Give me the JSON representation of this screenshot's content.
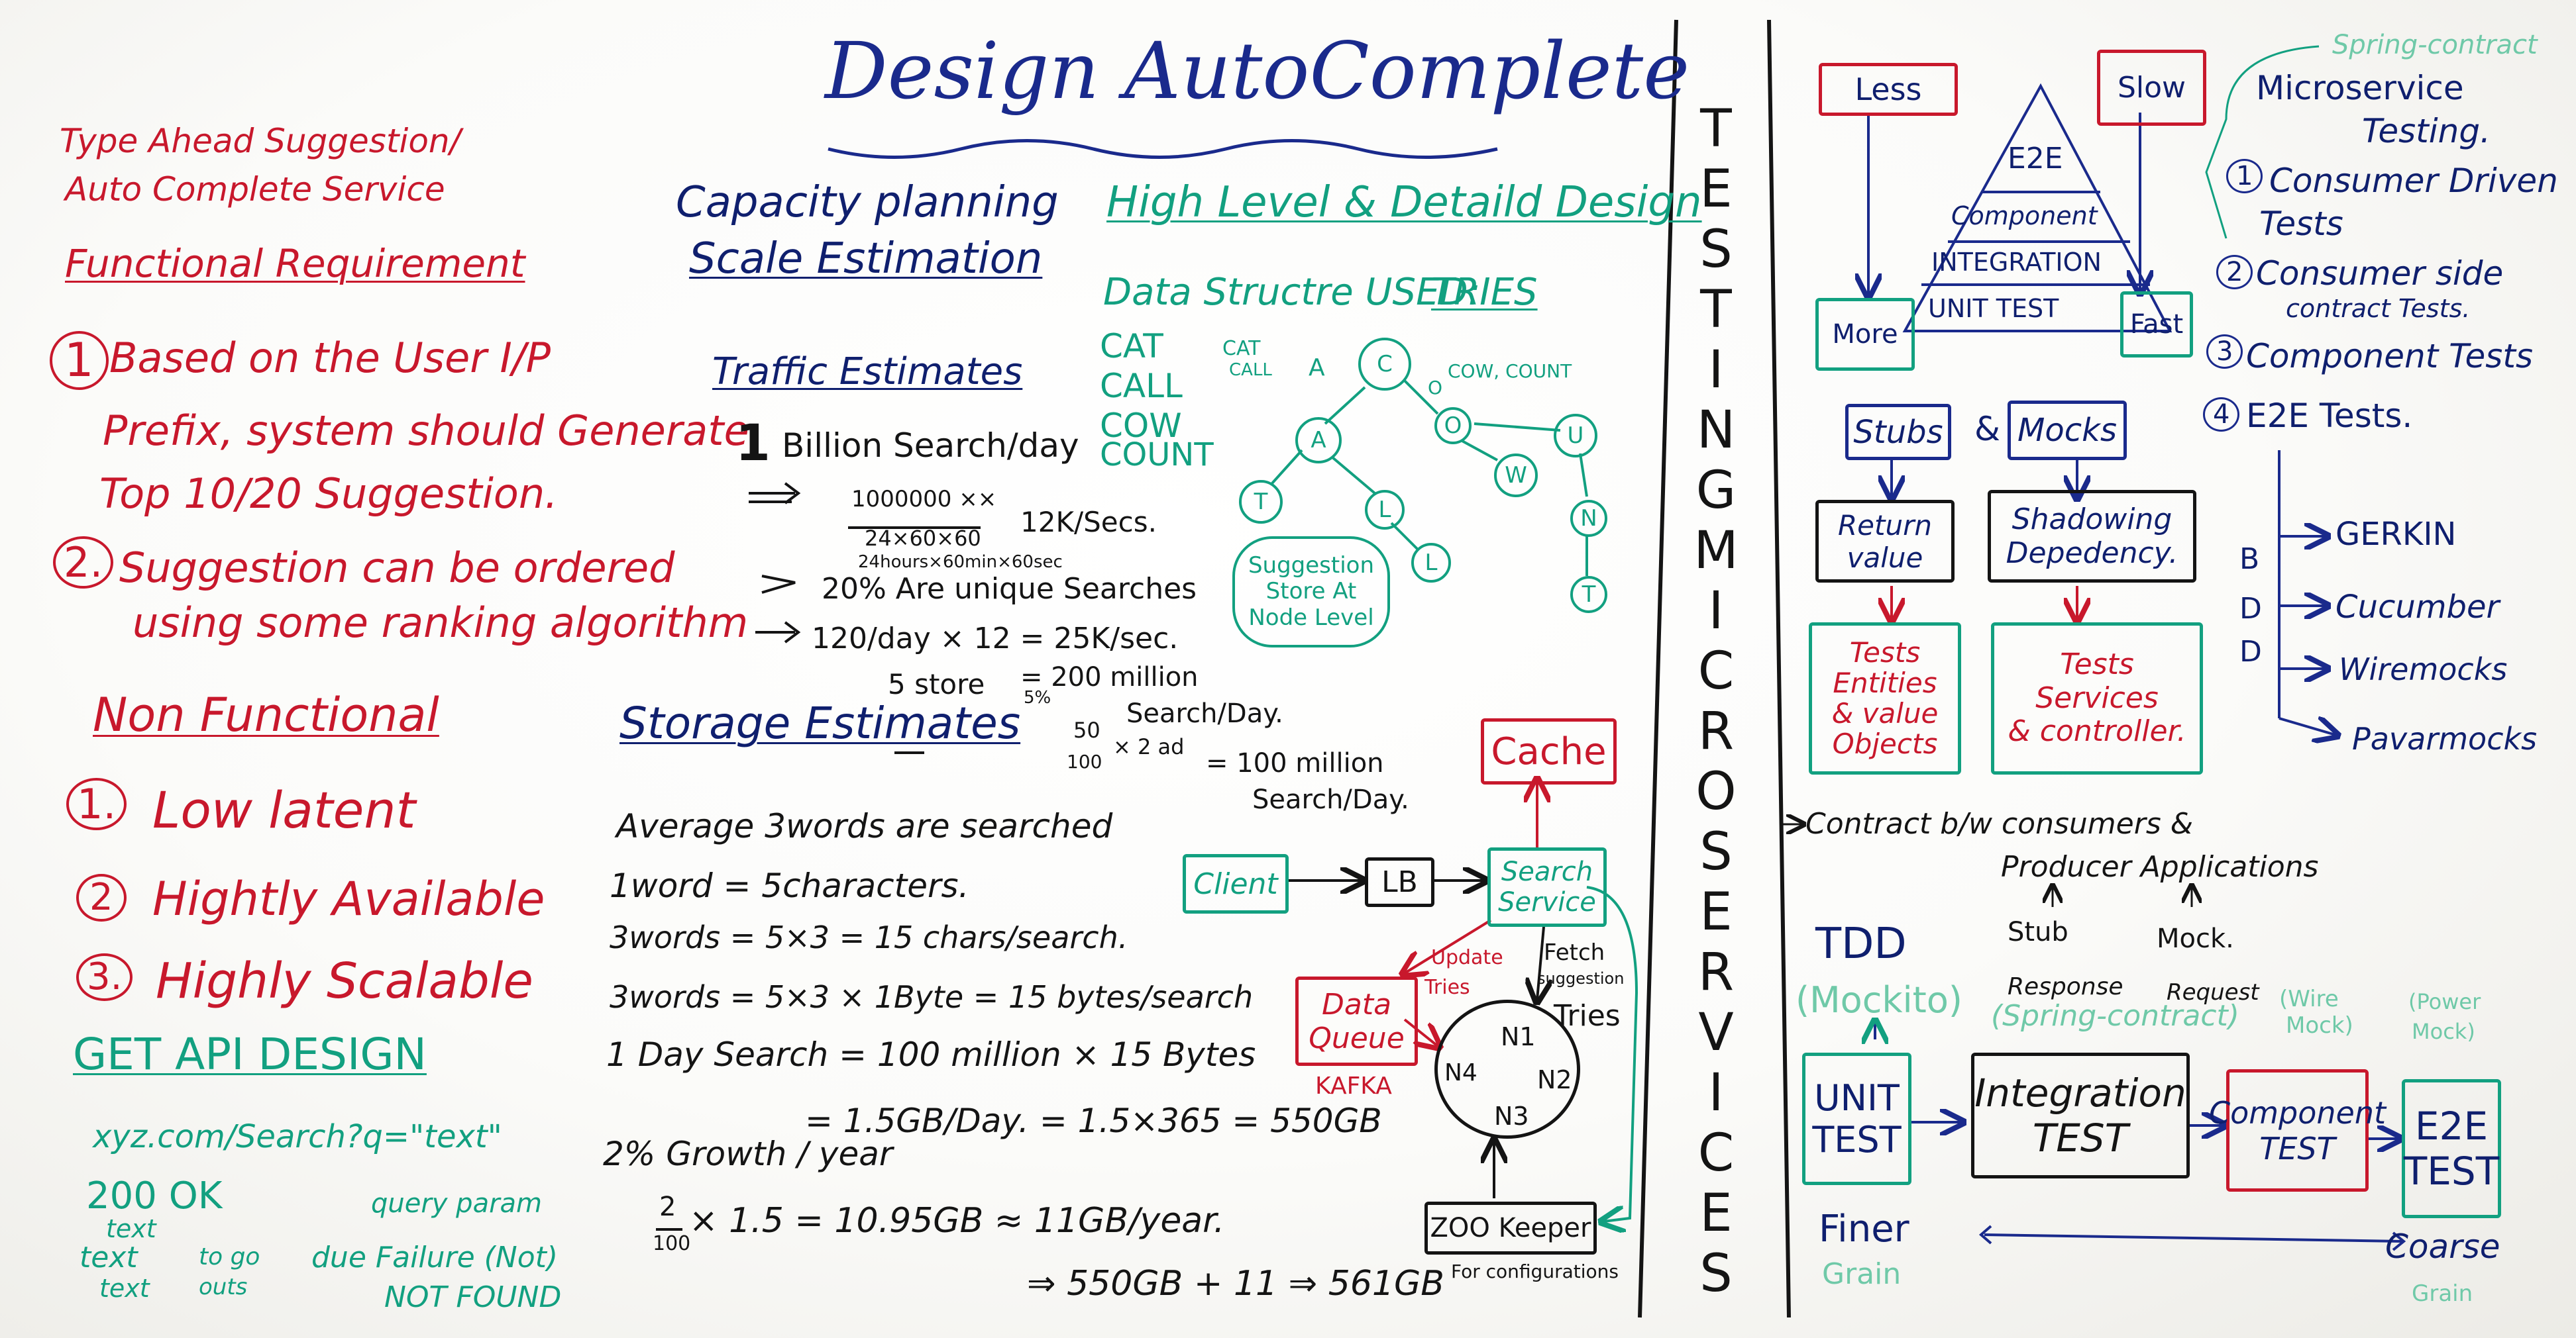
{
  "title": "Design AutoComplete",
  "left": {
    "service_name": [
      "Type Ahead Suggestion/",
      "Auto Complete Service"
    ],
    "functional_header": "Functional Requirement",
    "functional": [
      {
        "num": "1",
        "text": [
          "Based on the User I/P",
          "Prefix, system should Generate",
          "Top 10/20 Suggestion."
        ]
      },
      {
        "num": "2.",
        "text": [
          "Suggestion can be ordered",
          "using some ranking algorithm"
        ]
      }
    ],
    "non_functional_header": "Non Functional",
    "non_functional": [
      {
        "num": "1.",
        "text": "Low latent"
      },
      {
        "num": "2",
        "text": "Hightly Available"
      },
      {
        "num": "3.",
        "text": "Highly Scalable"
      }
    ],
    "api_header": "GET API DESIGN",
    "api_url": "xyz.com/Search?q=\"text\"",
    "api_query_param": "query param",
    "api_ok": "200 OK",
    "api_lines": [
      "text",
      "text",
      "text"
    ],
    "api_to_go": "to go",
    "api_outs": "outs",
    "api_failure": "due Failure (Not)",
    "api_not_found": "NOT FOUND"
  },
  "capacity": {
    "header": [
      "Capacity planning",
      "Scale Estimation"
    ],
    "traffic_header": "Traffic Estimates",
    "traffic_billion_num": "1",
    "traffic_billion": "Billion Search/day",
    "traffic_numerator": "1000000 ××",
    "traffic_denom": "24×60×60",
    "traffic_denom2": "24hours×60min×60sec",
    "traffic_result": "12K/Secs.",
    "unique": "20% Are unique Searches",
    "unique_calc": "120/day × 12 = 25K/sec.",
    "store_pct": "5%",
    "store": "5 store",
    "store_result": [
      "= 200 million",
      "Search/Day."
    ],
    "fraction_num": "50",
    "fraction_den": "100",
    "fraction_rest": "× 2 ad",
    "fraction_result": [
      "= 100 million",
      "Search/Day."
    ]
  },
  "storage": {
    "header": "Storage Estimates",
    "lines": [
      "Average 3words are searched",
      "1word = 5characters.",
      "3words = 5×3 = 15 chars/search.",
      "3words = 5×3 × 1Byte = 15 bytes/search",
      "1 Day Search = 100 million × 15 Bytes",
      "= 1.5GB/Day. = 1.5×365 = 550GB",
      "2% Growth / year"
    ],
    "frac_num": "2",
    "frac_den": "100",
    "growth_calc": "× 1.5 = 10.95GB ≈ 11GB/year.",
    "total": "⇒ 550GB + 11 ⇒ 561GB"
  },
  "design": {
    "header": "High Level & Detaild Design",
    "data_structure_label": "Data Structre USED:",
    "data_structure": "TRIES",
    "words": [
      "CAT",
      "CALL",
      "COW",
      "COUNT"
    ],
    "annot_cat": [
      "CAT",
      "CALL"
    ],
    "annot_cow": "COW, COUNT",
    "edge_a": "A",
    "edge_o": "O",
    "trie_nodes": [
      "C",
      "A",
      "O",
      "T",
      "L",
      "L",
      "W",
      "U",
      "N",
      "T"
    ],
    "suggestion_note": [
      "Suggestion",
      "Store At",
      "Node Level"
    ],
    "flow": {
      "client": "Client",
      "lb": "LB",
      "search": [
        "Search",
        "Service"
      ],
      "cache": "Cache",
      "queue": [
        "Data",
        "Queue"
      ],
      "kafka": "KAFKA",
      "update": [
        "Update",
        "Tries"
      ],
      "fetch": [
        "Fetch",
        "suggestion",
        "Tries"
      ],
      "nodes": [
        "N1",
        "N2",
        "N3",
        "N4"
      ],
      "zookeeper": "ZOO Keeper",
      "zookeeper_note": "For configurations"
    }
  },
  "divider": "TESTING MICROSERVICES",
  "right": {
    "less": "Less",
    "slow": "Slow",
    "more": "More",
    "fast": "Fast",
    "pyramid": [
      "E2E",
      "Component",
      "INTEGRATION",
      "UNIT TEST"
    ],
    "spring_contract": "Spring-contract",
    "list_header": [
      "Microservice",
      "Testing."
    ],
    "list": [
      {
        "num": "1",
        "text": [
          "Consumer Driven",
          "Tests"
        ]
      },
      {
        "num": "2",
        "text": [
          "Consumer side",
          "contract Tests."
        ]
      },
      {
        "num": "3",
        "text": [
          "Component Tests"
        ]
      },
      {
        "num": "4",
        "text": [
          "E2E Tests."
        ]
      }
    ],
    "bdd": [
      "B",
      "D",
      "D"
    ],
    "bdd_tools": [
      "GERKIN",
      "Cucumber",
      "Wiremocks",
      "Pavarmocks"
    ],
    "stubs": "Stubs",
    "and": "&",
    "mocks": "Mocks",
    "stub_target": [
      "Return",
      "value"
    ],
    "mock_target": [
      "Shadowing",
      "Depedency."
    ],
    "stub_tests": [
      "Tests",
      "Entities",
      "& value",
      "Objects"
    ],
    "mock_tests": [
      "Tests",
      "Services",
      "& controller."
    ],
    "contract_line": "Contract b/w consumers &",
    "producer_line": "Producer Applications",
    "stub": "Stub",
    "mock": "Mock.",
    "response": "Response",
    "request": "Request",
    "tdd": "TDD",
    "mockito": "(Mockito)",
    "spring_contract2": "(Spring-contract)",
    "wiremock": [
      "(Wire",
      "Mock)"
    ],
    "powermock": [
      "(Power",
      "Mock)"
    ],
    "stages": [
      [
        "UNIT",
        "TEST"
      ],
      [
        "Integration",
        "TEST"
      ],
      [
        "Component",
        "TEST"
      ],
      [
        "E2E",
        "TEST"
      ]
    ],
    "finer": "Finer",
    "grain": "Grain",
    "coarse": "Coarse",
    "grain2": "Grain",
    "colors": {
      "red": "#c8182c",
      "blue": "#1a2a8c",
      "green": "#12a080",
      "black": "#141414"
    }
  }
}
